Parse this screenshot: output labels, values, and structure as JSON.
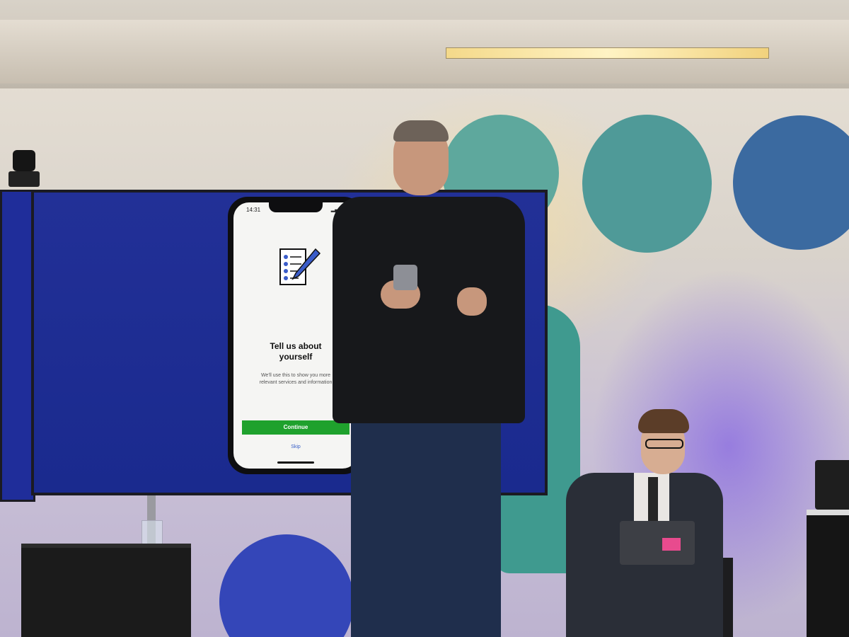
{
  "phone_app": {
    "status_time": "14:31",
    "title": "Tell us about\nyourself",
    "description": "We'll use this to show you more relevant services and information",
    "continue_label": "Continue",
    "skip_label": "Skip",
    "accent_color": "#1fa12d"
  },
  "scene": {
    "icons": [
      "checklist-pencil-icon",
      "signal-icon",
      "battery-icon"
    ]
  }
}
